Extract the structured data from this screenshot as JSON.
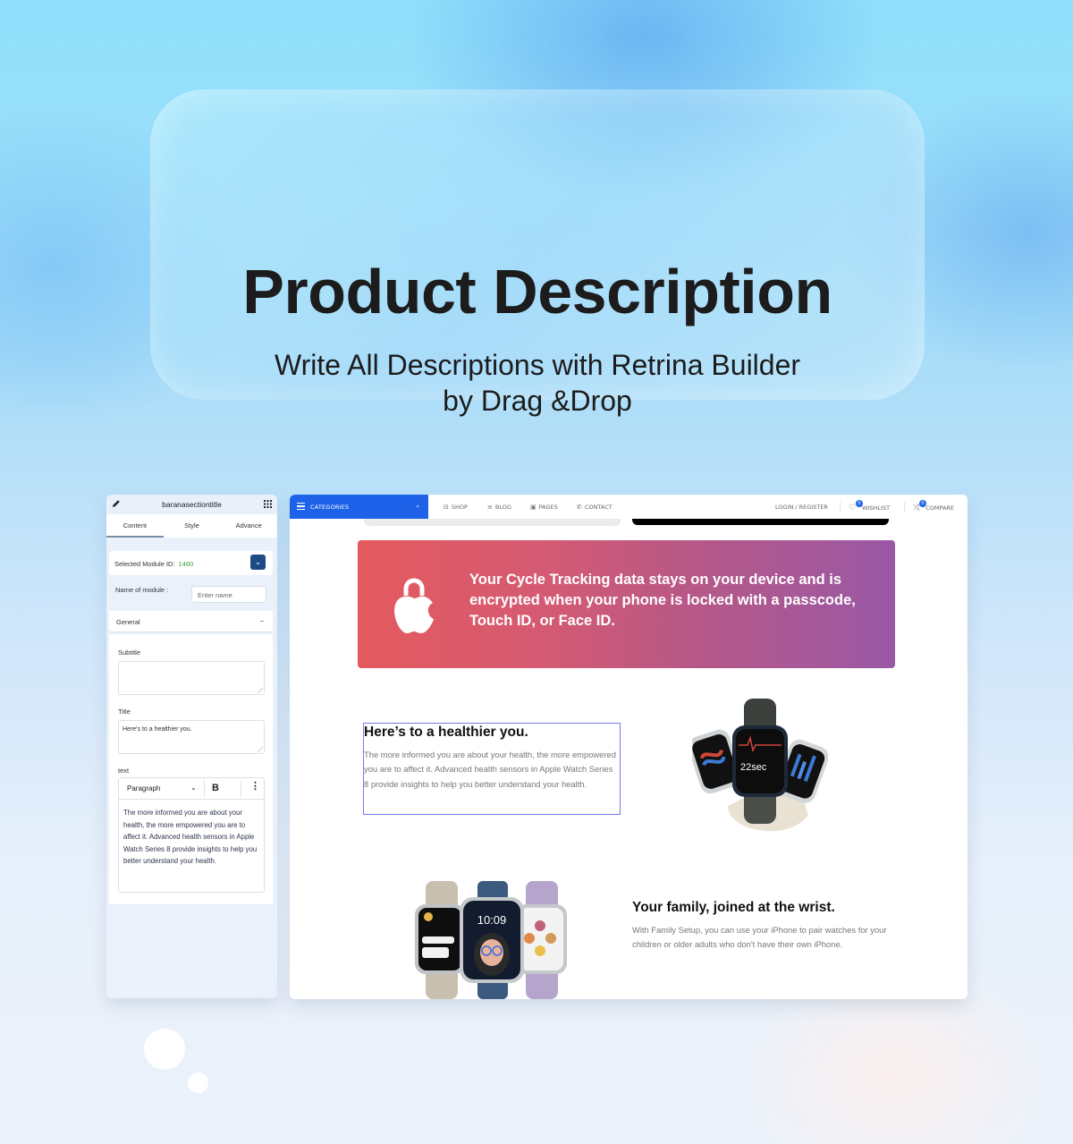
{
  "hero": {
    "title": "Product Description",
    "subtitle_line1": "Write All Descriptions with Retrina Builder",
    "subtitle_line2": "by Drag &Drop"
  },
  "editor_panel": {
    "header_title": "baranasectiontitle",
    "tabs": [
      {
        "label": "Content",
        "active": true
      },
      {
        "label": "Style",
        "active": false
      },
      {
        "label": "Advance",
        "active": false
      }
    ],
    "selected_module_label": "Selected Module ID:",
    "selected_module_id": "1460",
    "name_of_module_label": "Name of module :",
    "name_of_module_placeholder": "Enter name",
    "general_label": "General",
    "general_toggle": "–",
    "subtitle_label": "Subtitle",
    "subtitle_value": "",
    "title_label": "Title",
    "title_value": "Here's to a healthier you.",
    "text_label": "text",
    "text_format": "Paragraph",
    "bold_label": "B",
    "more_label": "⋮",
    "text_value": "The more informed you are about your health, the more empowered you are to affect it. Advanced health sensors in Apple Watch Series 8 provide insights to help you better understand your health."
  },
  "site": {
    "categories_label": "CATEGORIES",
    "nav": [
      {
        "label": "SHOP",
        "icon": "shop-icon"
      },
      {
        "label": "BLOG",
        "icon": "blog-icon"
      },
      {
        "label": "PAGES",
        "icon": "pages-icon"
      },
      {
        "label": "CONTACT",
        "icon": "phone-icon"
      }
    ],
    "login_label": "LOGIN / REGISTER",
    "wishlist_label": "WISHLIST",
    "wishlist_count": "0",
    "compare_label": "COMPARE",
    "compare_count": "0",
    "promo_text": "Your Cycle Tracking data stays on your device and is encrypted when your phone is locked with a passcode, Touch ID, or Face ID.",
    "section1_title": "Here’s to a healthier you.",
    "section1_text": "The more informed you are about your health, the more empowered you are to affect it. Advanced health sensors in Apple Watch Series 8 provide insights to help you better understand your health.",
    "watch1_time": "22sec",
    "section2_title": "Your family, joined at the wrist.",
    "section2_text": "With Family Setup, you can use your iPhone to pair watches for your children or older adults who don't have their own iPhone.",
    "watch2_time": "10:09",
    "colors": {
      "accent": "#1d62e8",
      "promo_start": "#e45a5d",
      "promo_end": "#9a58a6",
      "selection": "#7878ee",
      "module_id": "#3aa33a"
    }
  }
}
